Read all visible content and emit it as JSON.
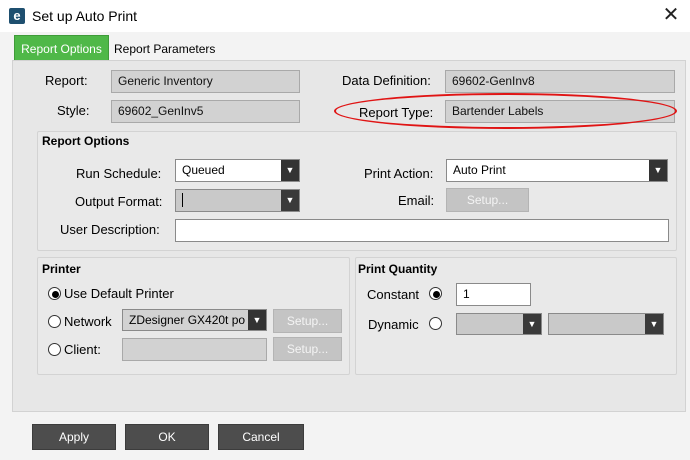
{
  "window": {
    "title": "Set up Auto Print",
    "app_icon": "e",
    "close_symbol": "✕"
  },
  "tabs": [
    {
      "label": "Report Options",
      "active": true
    },
    {
      "label": "Report Parameters",
      "active": false
    }
  ],
  "report": {
    "report_label": "Report:",
    "report_value": "Generic Inventory",
    "style_label": "Style:",
    "style_value": "69602_GenInv5",
    "data_def_label": "Data Definition:",
    "data_def_value": "69602-GenInv8",
    "report_type_label": "Report Type:",
    "report_type_value": "Bartender Labels"
  },
  "report_options": {
    "title": "Report Options",
    "run_schedule_label": "Run Schedule:",
    "run_schedule_value": "Queued",
    "output_format_label": "Output Format:",
    "output_format_value": "",
    "print_action_label": "Print Action:",
    "print_action_value": "Auto Print",
    "email_label": "Email:",
    "email_setup": "Setup...",
    "user_desc_label": "User Description:",
    "user_desc_value": ""
  },
  "printer": {
    "title": "Printer",
    "use_default_label": "Use Default Printer",
    "network_label": "Network",
    "network_value": "ZDesigner GX420t po",
    "network_setup": "Setup...",
    "client_label": "Client:",
    "client_setup": "Setup...",
    "selected": "default"
  },
  "print_quantity": {
    "title": "Print Quantity",
    "constant_label": "Constant",
    "constant_value": "1",
    "dynamic_label": "Dynamic",
    "selected": "constant"
  },
  "buttons": {
    "apply": "Apply",
    "ok": "OK",
    "cancel": "Cancel"
  },
  "colors": {
    "tab_active": "#4fb848",
    "annotation": "#e01414",
    "button_dark": "#4d4d4d"
  }
}
